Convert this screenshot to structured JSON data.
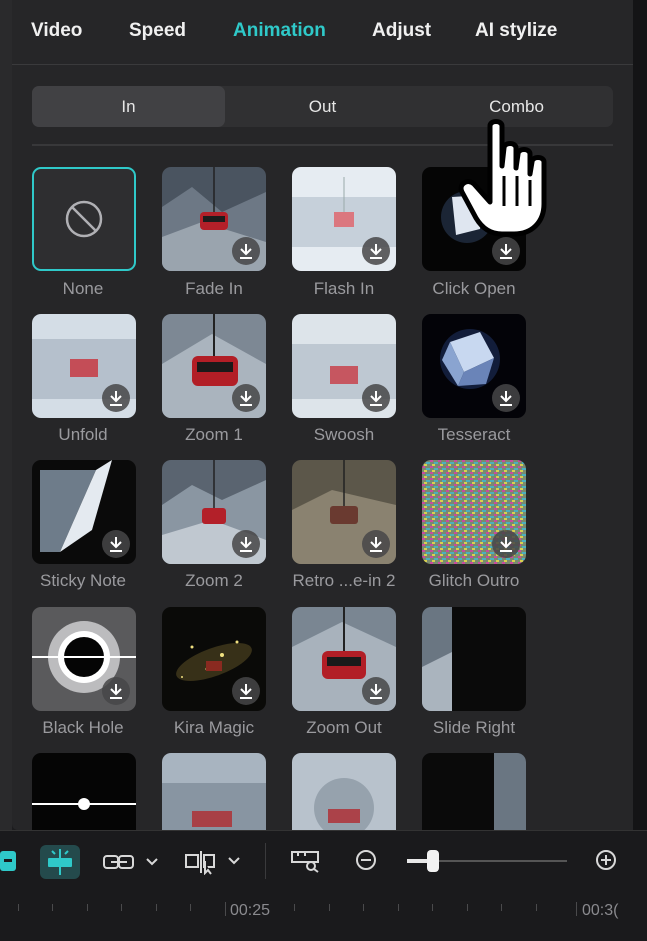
{
  "tabs": [
    "Video",
    "Speed",
    "Animation",
    "Adjust",
    "AI stylize"
  ],
  "active_tab": "Animation",
  "segments": [
    "In",
    "Out",
    "Combo"
  ],
  "active_segment": "In",
  "animations": [
    {
      "label": "None"
    },
    {
      "label": "Fade In"
    },
    {
      "label": "Flash In"
    },
    {
      "label": "Click Open"
    },
    {
      "label": "Unfold"
    },
    {
      "label": "Zoom 1"
    },
    {
      "label": "Swoosh"
    },
    {
      "label": "Tesseract"
    },
    {
      "label": "Sticky Note"
    },
    {
      "label": "Zoom 2"
    },
    {
      "label": "Retro ...e-in 2"
    },
    {
      "label": "Glitch Outro"
    },
    {
      "label": "Black Hole"
    },
    {
      "label": "Kira Magic"
    },
    {
      "label": "Zoom Out"
    },
    {
      "label": "Slide Right"
    }
  ],
  "timeline": {
    "times": [
      "00:25",
      "00:3("
    ]
  },
  "colors": {
    "accent": "#2fc9c9",
    "panel": "#262628",
    "background": "#1c1c1e"
  }
}
